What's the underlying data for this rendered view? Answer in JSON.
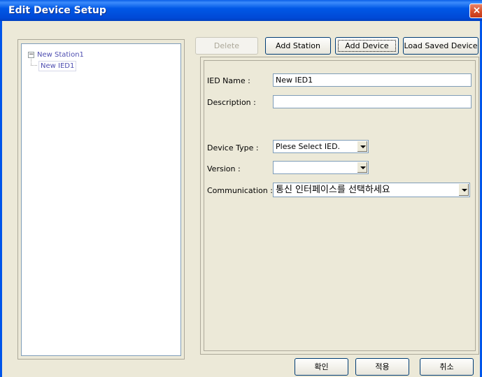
{
  "window": {
    "title": "Edit Device Setup",
    "close_glyph": "×"
  },
  "tree": {
    "expander_glyph": "−",
    "station": "New Station1",
    "device": "New IED1"
  },
  "toolbar": {
    "delete_label": "Delete",
    "add_station_label": "Add Station",
    "add_device_label": "Add Device",
    "load_saved_label": "Load Saved Device"
  },
  "form": {
    "ied_name_label": "IED Name :",
    "ied_name_value": "New IED1",
    "description_label": "Description :",
    "description_value": "",
    "device_type_label": "Device Type :",
    "device_type_value": "Plese Select IED.",
    "version_label": "Version :",
    "version_value": "",
    "communication_label": "Communication :",
    "communication_value": "통신 인터페이스를 선택하세요"
  },
  "footer": {
    "ok_label": "확인",
    "apply_label": "적용",
    "cancel_label": "취소"
  },
  "colors": {
    "title_bar": "#0058e6",
    "dialog_bg": "#ece9d8",
    "tree_text": "#4e4eb0",
    "close_button": "#d54a25"
  }
}
